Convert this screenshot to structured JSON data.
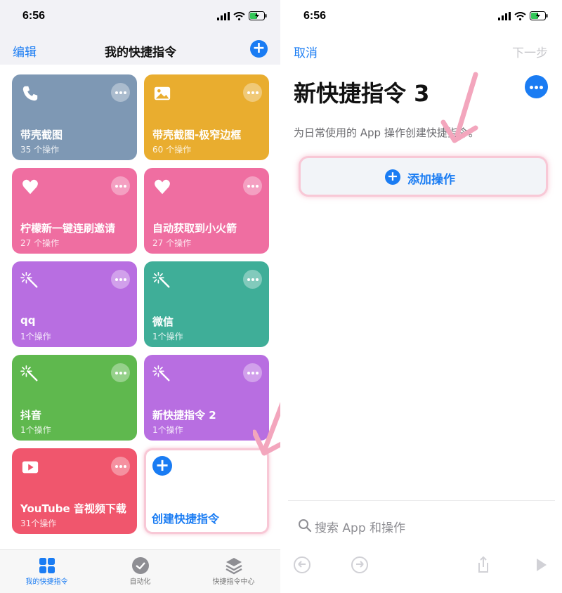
{
  "left": {
    "time": "6:56",
    "nav": {
      "edit": "编辑",
      "title": "我的快捷指令"
    },
    "cards": [
      {
        "name": "带壳截图",
        "count": "35 个操作",
        "color": "#7e98b4",
        "icon": "phone-icon"
      },
      {
        "name": "带壳截图-极窄边框",
        "count": "60 个操作",
        "color": "#e9ad2f",
        "icon": "image-icon"
      },
      {
        "name": "柠檬新一键连刷邀请",
        "count": "27 个操作",
        "color": "#ef6ea1",
        "icon": "heart-icon"
      },
      {
        "name": "自动获取到小火箭",
        "count": "27 个操作",
        "color": "#ef6ea1",
        "icon": "heart-icon"
      },
      {
        "name": "qq",
        "count": "1个操作",
        "color": "#b86ee1",
        "icon": "magic-wand-icon"
      },
      {
        "name": "微信",
        "count": "1个操作",
        "color": "#3fae98",
        "icon": "magic-wand-icon"
      },
      {
        "name": "抖音",
        "count": "1个操作",
        "color": "#5fb84e",
        "icon": "magic-wand-icon"
      },
      {
        "name": "新快捷指令 2",
        "count": "1个操作",
        "color": "#b86ee1",
        "icon": "magic-wand-icon"
      },
      {
        "name": "YouTube 音视频下载",
        "count": "31个操作",
        "color": "#f0566d",
        "icon": "play-icon"
      }
    ],
    "create": "创建快捷指令",
    "tabs": [
      {
        "label": "我的快捷指令",
        "icon": "grid-icon"
      },
      {
        "label": "自动化",
        "icon": "clock-icon"
      },
      {
        "label": "快捷指令中心",
        "icon": "layers-icon"
      }
    ]
  },
  "right": {
    "time": "6:56",
    "cancel": "取消",
    "next": "下一步",
    "title": "新快捷指令 3",
    "description": "为日常使用的 App 操作创建快捷指令。",
    "add_action": "添加操作",
    "search_placeholder": "搜索 App 和操作"
  },
  "colors": {
    "accent": "#1a7cf3",
    "highlight": "#f8c8d6"
  }
}
